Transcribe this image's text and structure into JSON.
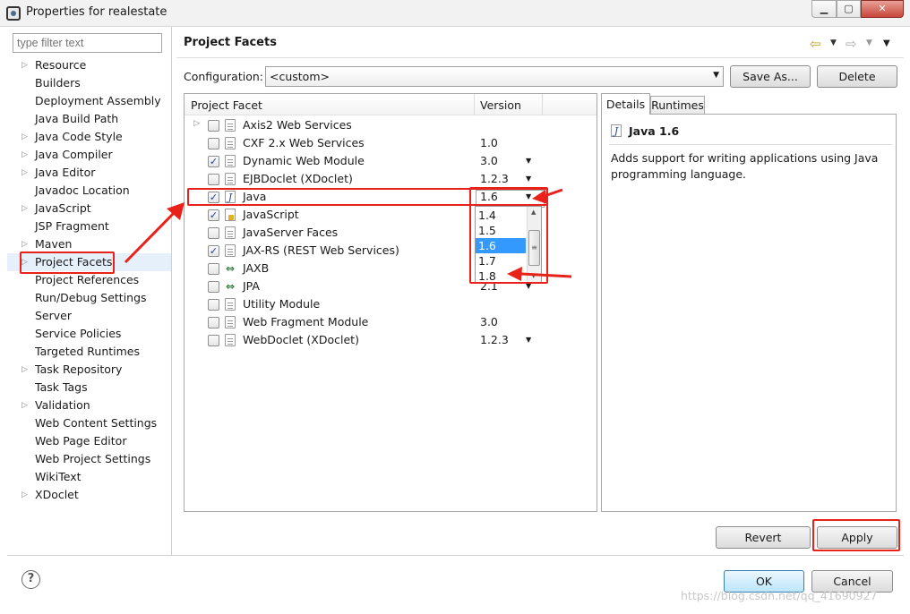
{
  "window": {
    "title": "Properties for realestate",
    "min": "▁",
    "max": "▢",
    "close": "✕"
  },
  "nav": {
    "filter_placeholder": "type filter text",
    "items": [
      {
        "label": "Resource",
        "expandable": true
      },
      {
        "label": "Builders",
        "expandable": false
      },
      {
        "label": "Deployment Assembly",
        "expandable": false
      },
      {
        "label": "Java Build Path",
        "expandable": false
      },
      {
        "label": "Java Code Style",
        "expandable": true
      },
      {
        "label": "Java Compiler",
        "expandable": true
      },
      {
        "label": "Java Editor",
        "expandable": true
      },
      {
        "label": "Javadoc Location",
        "expandable": false
      },
      {
        "label": "JavaScript",
        "expandable": true
      },
      {
        "label": "JSP Fragment",
        "expandable": false
      },
      {
        "label": "Maven",
        "expandable": true
      },
      {
        "label": "Project Facets",
        "expandable": true,
        "selected": true
      },
      {
        "label": "Project References",
        "expandable": false
      },
      {
        "label": "Run/Debug Settings",
        "expandable": false
      },
      {
        "label": "Server",
        "expandable": false
      },
      {
        "label": "Service Policies",
        "expandable": false
      },
      {
        "label": "Targeted Runtimes",
        "expandable": false
      },
      {
        "label": "Task Repository",
        "expandable": true
      },
      {
        "label": "Task Tags",
        "expandable": false
      },
      {
        "label": "Validation",
        "expandable": true
      },
      {
        "label": "Web Content Settings",
        "expandable": false
      },
      {
        "label": "Web Page Editor",
        "expandable": false
      },
      {
        "label": "Web Project Settings",
        "expandable": false
      },
      {
        "label": "WikiText",
        "expandable": false
      },
      {
        "label": "XDoclet",
        "expandable": true
      }
    ]
  },
  "header": {
    "title": "Project Facets",
    "back_icon": "back-arrow-icon",
    "forward_icon": "forward-arrow-icon",
    "menu_icon": "view-menu-icon"
  },
  "configuration": {
    "label": "Configuration:",
    "value": "<custom>",
    "save_as": "Save As...",
    "delete": "Delete"
  },
  "facets": {
    "col_facet": "Project Facet",
    "col_version": "Version",
    "rows": [
      {
        "name": "Axis2 Web Services",
        "checked": false,
        "version": "",
        "dropdown": false,
        "expandable": true,
        "icon": "doc-icon"
      },
      {
        "name": "CXF 2.x Web Services",
        "checked": false,
        "version": "1.0",
        "dropdown": false,
        "icon": "doc-icon"
      },
      {
        "name": "Dynamic Web Module",
        "checked": true,
        "version": "3.0",
        "dropdown": true,
        "icon": "doc-icon"
      },
      {
        "name": "EJBDoclet (XDoclet)",
        "checked": false,
        "version": "1.2.3",
        "dropdown": true,
        "icon": "doc-icon"
      },
      {
        "name": "Java",
        "checked": true,
        "version": "1.6",
        "dropdown": true,
        "icon": "java-icon"
      },
      {
        "name": "JavaScript",
        "checked": true,
        "version": "",
        "dropdown": false,
        "icon": "javascript-icon"
      },
      {
        "name": "JavaServer Faces",
        "checked": false,
        "version": "",
        "dropdown": false,
        "icon": "doc-icon"
      },
      {
        "name": "JAX-RS (REST Web Services)",
        "checked": true,
        "version": "",
        "dropdown": false,
        "icon": "doc-icon"
      },
      {
        "name": "JAXB",
        "checked": false,
        "version": "",
        "dropdown": false,
        "icon": "webservice-icon"
      },
      {
        "name": "JPA",
        "checked": false,
        "version": "2.1",
        "dropdown": true,
        "icon": "webservice-icon"
      },
      {
        "name": "Utility Module",
        "checked": false,
        "version": "",
        "dropdown": false,
        "icon": "doc-icon"
      },
      {
        "name": "Web Fragment Module",
        "checked": false,
        "version": "3.0",
        "dropdown": false,
        "icon": "doc-icon"
      },
      {
        "name": "WebDoclet (XDoclet)",
        "checked": false,
        "version": "1.2.3",
        "dropdown": true,
        "icon": "doc-icon"
      }
    ],
    "version_options": [
      "1.4",
      "1.5",
      "1.6",
      "1.7",
      "1.8"
    ],
    "selected_version": "1.6"
  },
  "details": {
    "tab_details": "Details",
    "tab_runtimes": "Runtimes",
    "title": "Java 1.6",
    "description": "Adds support for writing applications using Java programming language."
  },
  "buttons": {
    "revert": "Revert",
    "apply": "Apply",
    "ok": "OK",
    "cancel": "Cancel"
  },
  "watermark": "https://blog.csdn.net/qq_41690927",
  "annotation_color": "#e8221a"
}
